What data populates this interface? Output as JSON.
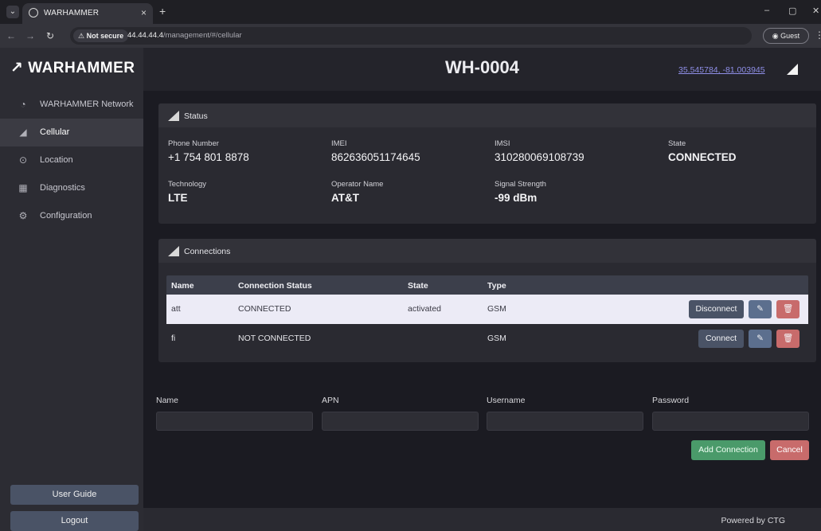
{
  "browser": {
    "tab_title": "WARHAMMER",
    "tab_close": "×",
    "new_tab": "+",
    "warning_label": "Not secure",
    "url_host": "44.44.44.4",
    "url_path": "/management/#/cellular",
    "guest_label": "Guest"
  },
  "sidebar": {
    "brand": "WARHAMMER",
    "items": [
      {
        "label": "WARHAMMER Network",
        "icon": "dashboard-icon"
      },
      {
        "label": "Cellular",
        "icon": "signal-icon"
      },
      {
        "label": "Location",
        "icon": "location-pin-icon"
      },
      {
        "label": "Diagnostics",
        "icon": "chip-icon"
      },
      {
        "label": "Configuration",
        "icon": "gear-icon"
      }
    ],
    "user_guide": "User Guide",
    "logout": "Logout"
  },
  "header": {
    "device_name": "WH-0004",
    "coordinates": "35.545784, -81.003945"
  },
  "status": {
    "title": "Status",
    "fields": [
      {
        "label": "Phone Number",
        "value": "+1 754 801 8878"
      },
      {
        "label": "IMEI",
        "value": "862636051174645"
      },
      {
        "label": "IMSI",
        "value": "310280069108739"
      },
      {
        "label": "State",
        "value": "CONNECTED"
      },
      {
        "label": "Technology",
        "value": "LTE"
      },
      {
        "label": "Operator Name",
        "value": "AT&T"
      },
      {
        "label": "Signal Strength",
        "value": "-99 dBm"
      }
    ]
  },
  "connections": {
    "title": "Connections",
    "columns": [
      "Name",
      "Connection Status",
      "State",
      "Type"
    ],
    "rows": [
      {
        "name": "att",
        "status": "CONNECTED",
        "state": "activated",
        "type": "GSM",
        "action": "Disconnect"
      },
      {
        "name": "fi",
        "status": "NOT CONNECTED",
        "state": "",
        "type": "GSM",
        "action": "Connect"
      }
    ]
  },
  "form": {
    "name_label": "Name",
    "apn_label": "APN",
    "username_label": "Username",
    "password_label": "Password",
    "name_value": "",
    "apn_value": "",
    "username_value": "",
    "password_value": "",
    "add_label": "Add Connection",
    "cancel_label": "Cancel"
  },
  "footer": {
    "powered_by": "Powered by CTG"
  }
}
